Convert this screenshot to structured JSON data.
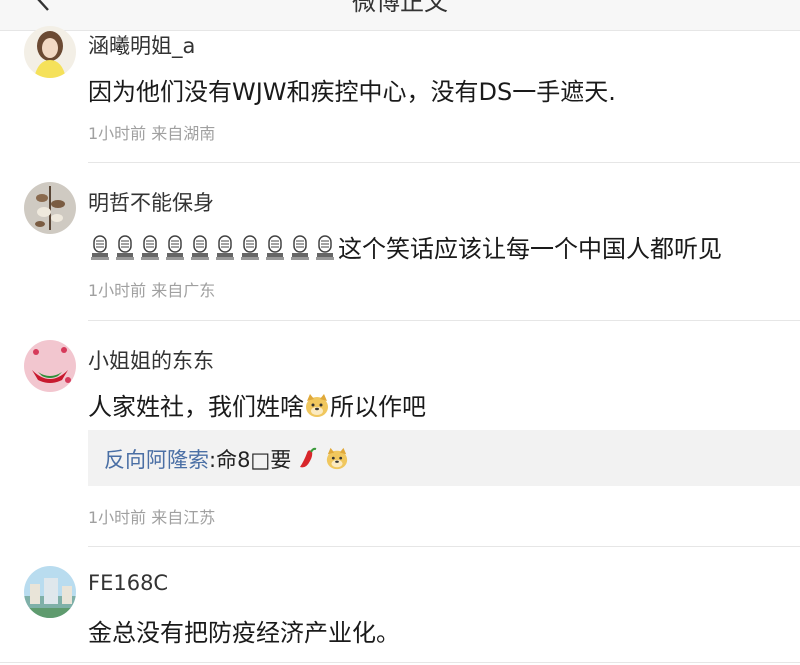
{
  "header": {
    "title": "微博正文"
  },
  "comments": [
    {
      "username": "涵曦明姐_a",
      "text": "因为他们没有WJW和疾控中心，没有DS一手遮天.",
      "meta": "1小时前 来自湖南"
    },
    {
      "username": "明哲不能保身",
      "text": "这个笑话应该让每一个中国人都听见",
      "meta": "1小时前 来自广东",
      "emoji_prefix": "microphone-icon"
    },
    {
      "username": "小姐姐的东东",
      "text_before": "人家姓社，我们姓啥",
      "text_after": "所以作吧",
      "emoji": "doge-icon",
      "reply": {
        "name": "反向阿隆索",
        "text": ":命8□要"
      },
      "meta": "1小时前 来自江苏"
    },
    {
      "username": "FE168C",
      "text": "金总没有把防疫经济产业化。"
    }
  ]
}
